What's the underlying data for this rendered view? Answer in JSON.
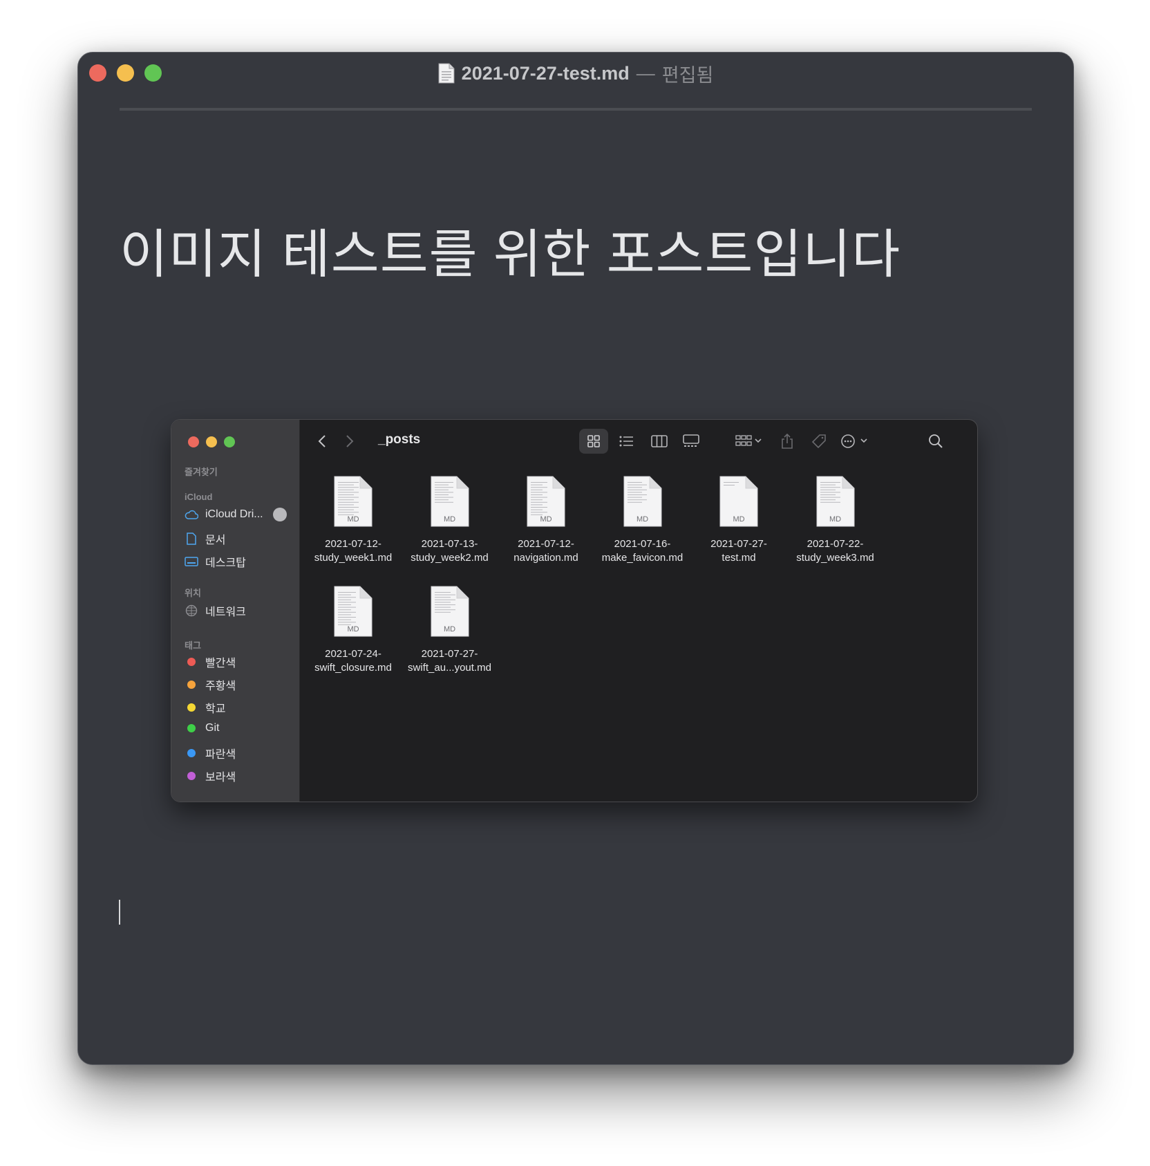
{
  "window": {
    "title_file": "2021-07-27-test.md",
    "title_sep": "—",
    "title_state": "편집됨",
    "heading": "이미지 테스트를 위한 포스트입니다"
  },
  "finder": {
    "folder": "_posts",
    "sidebar": {
      "favorites_label": "즐겨찾기",
      "icloud_label": "iCloud",
      "icloud_items": [
        {
          "label": "iCloud Dri...",
          "icon": "cloud-icon"
        },
        {
          "label": "문서",
          "icon": "document-icon"
        },
        {
          "label": "데스크탑",
          "icon": "desktop-icon"
        }
      ],
      "locations_label": "위치",
      "locations_items": [
        {
          "label": "네트워크",
          "icon": "globe-icon"
        }
      ],
      "tags_label": "태그",
      "tags": [
        {
          "label": "빨간색",
          "color": "#ed5b55"
        },
        {
          "label": "주황색",
          "color": "#f6a33c"
        },
        {
          "label": "학교",
          "color": "#f5d834"
        },
        {
          "label": "Git",
          "color": "#3ecf48"
        },
        {
          "label": "파란색",
          "color": "#3a98f5"
        },
        {
          "label": "보라색",
          "color": "#c25fd6"
        }
      ]
    },
    "file_badge": "MD",
    "files": [
      {
        "line1": "2021-07-12-",
        "line2": "study_week1.md"
      },
      {
        "line1": "2021-07-13-",
        "line2": "study_week2.md"
      },
      {
        "line1": "2021-07-12-",
        "line2": "navigation.md"
      },
      {
        "line1": "2021-07-16-",
        "line2": "make_favicon.md"
      },
      {
        "line1": "2021-07-27-",
        "line2": "test.md"
      },
      {
        "line1": "2021-07-22-",
        "line2": "study_week3.md"
      },
      {
        "line1": "2021-07-24-",
        "line2": "swift_closure.md"
      },
      {
        "line1": "2021-07-27-",
        "line2": "swift_au...yout.md"
      }
    ]
  }
}
